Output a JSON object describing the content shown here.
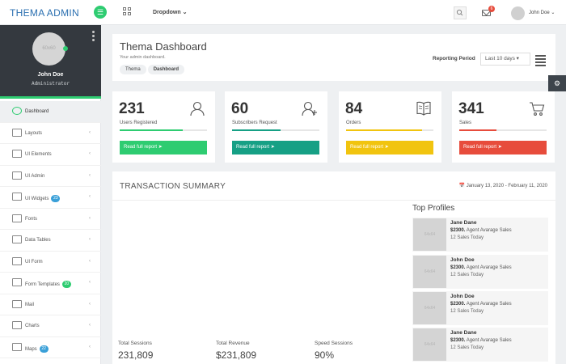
{
  "header": {
    "brand": "THEMA ADMIN",
    "dropdown_label": "Dropdown",
    "mail_count": "6",
    "user_name": "John Doe"
  },
  "sidebar": {
    "user_name": "John Doe",
    "user_role": "Administrator",
    "avatar_placeholder": "60x60",
    "items": [
      {
        "label": "Dashboard",
        "badge": "",
        "active": true
      },
      {
        "label": "Layouts",
        "badge": ""
      },
      {
        "label": "UI Elements",
        "badge": ""
      },
      {
        "label": "UI Admin",
        "badge": ""
      },
      {
        "label": "UI Widgets",
        "badge": "23"
      },
      {
        "label": "Fonts",
        "badge": ""
      },
      {
        "label": "Data Tables",
        "badge": ""
      },
      {
        "label": "UI Form",
        "badge": ""
      },
      {
        "label": "Form Templates",
        "badge": "20"
      },
      {
        "label": "Mail",
        "badge": ""
      },
      {
        "label": "Charts",
        "badge": ""
      },
      {
        "label": "Maps",
        "badge": "22"
      }
    ]
  },
  "dashboard": {
    "title": "Thema Dashboard",
    "subtitle": "Your admin dashboard.",
    "breadcrumbs": [
      "Thema",
      "Dashboard"
    ],
    "reporting_label": "Reporting Period",
    "reporting_value": "Last 10 days"
  },
  "stats": [
    {
      "value": "231",
      "label": "Users Registered",
      "button": "Read full report",
      "color": "#2ecc71",
      "progress": 0.72,
      "icon": "user-icon"
    },
    {
      "value": "60",
      "label": "Subscribers Request",
      "button": "Read full report",
      "color": "#16a085",
      "progress": 0.56,
      "icon": "user-add-icon"
    },
    {
      "value": "84",
      "label": "Orders",
      "button": "Read full report",
      "color": "#f1c40f",
      "progress": 0.87,
      "icon": "book-icon"
    },
    {
      "value": "341",
      "label": "Sales",
      "button": "Read full report",
      "color": "#e74c3c",
      "progress": 0.43,
      "icon": "cart-icon"
    }
  ],
  "transactions": {
    "title": "TRANSACTION SUMMARY",
    "date_range": "January 13, 2020 - February 11, 2020",
    "metrics": [
      {
        "label": "Total Sessions",
        "value": "231,809"
      },
      {
        "label": "Total Revenue",
        "value": "$231,809"
      },
      {
        "label": "Speed Sessions",
        "value": "90%"
      }
    ]
  },
  "top_profiles": {
    "title": "Top Profiles",
    "sales_suffix": "Agent Avarage Sales",
    "count_suffix": "Sales Today",
    "thumb_placeholder": "64x64",
    "items": [
      {
        "name": "Jane Dane",
        "sales": "$2300.",
        "count": "12"
      },
      {
        "name": "John Doe",
        "sales": "$2300.",
        "count": "12"
      },
      {
        "name": "John Doe",
        "sales": "$2300.",
        "count": "12"
      },
      {
        "name": "Jane Dane",
        "sales": "$2300.",
        "count": "12"
      }
    ]
  }
}
